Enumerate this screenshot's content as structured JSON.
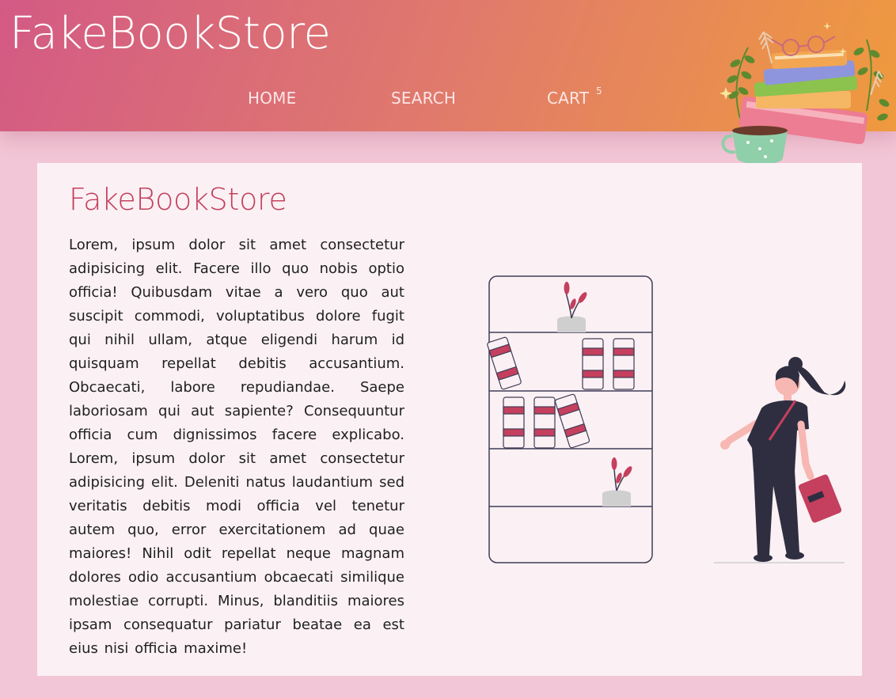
{
  "header": {
    "brand": "FakeBookStore",
    "nav": {
      "home": "HOME",
      "search": "SEARCH",
      "cart": "CART",
      "cart_count": "5"
    },
    "gradient": [
      "#d35a85",
      "#ef9a3e"
    ]
  },
  "main": {
    "title": "FakeBookStore",
    "body": "Lorem, ipsum dolor sit amet consectetur adipisicing elit. Facere illo quo nobis optio officia! Quibusdam vitae a vero quo aut suscipit commodi, voluptatibus dolore fugit qui nihil ullam, atque eligendi harum id quisquam repellat debitis accusantium. Obcaecati, labore repudiandae. Saepe laboriosam qui aut sapiente? Consequuntur officia cum dignissimos facere explicabo. Lorem, ipsum dolor sit amet consectetur adipisicing elit. Deleniti natus laudantium sed veritatis debitis modi officia vel tenetur autem quo, error exercitationem ad quae maiores! Nihil odit repellat neque magnam dolores odio accusantium obcaecati similique molestiae corrupti. Minus, blanditiis maiores ipsam consequatur pariatur beatae ea est eius nisi officia maxime!"
  },
  "illustrations": {
    "header_decoration": "book-stack-illustration",
    "hero": "bookshelf-woman-illustration"
  },
  "colors": {
    "page_bg": "#f2c6d6",
    "panel_bg": "#fbf1f4",
    "accent": "#c4405e"
  }
}
